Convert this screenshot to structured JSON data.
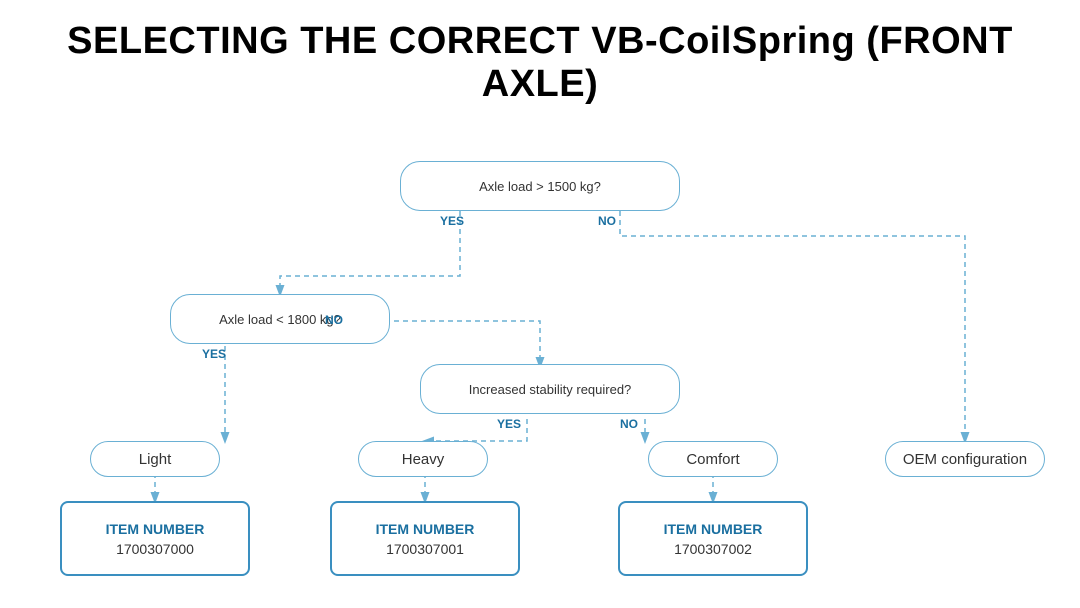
{
  "page": {
    "title": "SELECTING THE CORRECT VB-CoilSpring (FRONT AXLE)",
    "diagram": {
      "decision1": {
        "text": "Axle load > 1500 kg?",
        "yes": "YES",
        "no": "NO"
      },
      "decision2": {
        "text": "Axle load < 1800 kg?",
        "yes": "YES",
        "no": "NO"
      },
      "decision3": {
        "text": "Increased stability required?",
        "yes": "YES",
        "no": "NO"
      },
      "results": [
        {
          "label": "Light",
          "id": "light"
        },
        {
          "label": "Heavy",
          "id": "heavy"
        },
        {
          "label": "Comfort",
          "id": "comfort"
        },
        {
          "label": "OEM configuration",
          "id": "oem"
        }
      ],
      "items": [
        {
          "label": "ITEM NUMBER",
          "number": "1700307000",
          "id": "item0"
        },
        {
          "label": "ITEM NUMBER",
          "number": "1700307001",
          "id": "item1"
        },
        {
          "label": "ITEM NUMBER",
          "number": "1700307002",
          "id": "item2"
        }
      ]
    }
  }
}
